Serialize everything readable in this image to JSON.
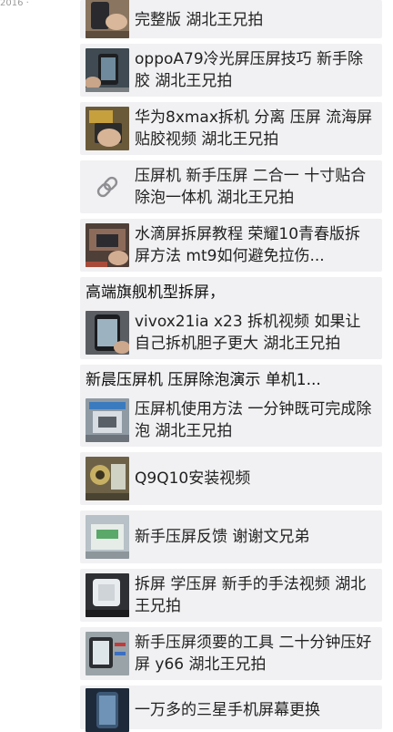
{
  "top_stub": "2016 ·",
  "feed": {
    "items": [
      {
        "title": "完整版 湖北王兄拍",
        "thumb": "thumb-phone-repair-hands"
      },
      {
        "title": "oppoA79冷光屏压屏技巧 新手除胶 湖北王兄拍",
        "thumb": "thumb-phone-on-mat"
      },
      {
        "title": "华为8xmax拆机 分离 压屏 流海屏贴胶视频 湖北王兄拍",
        "thumb": "thumb-hand-on-phone"
      },
      {
        "title": "压屏机 新手压屏 二合一 十寸贴合除泡一体机 湖北王兄拍",
        "thumb": "link-icon"
      },
      {
        "title": "水滴屏拆屏教程 荣耀10青春版拆屏方法 mt9如何避免拉伤...",
        "thumb": "thumb-disassembly"
      },
      {
        "heading": "高端旗舰机型拆屏，",
        "title": "vivox21ia x23 拆机视频 如果让自己拆机胆子更大 湖北王兄拍",
        "thumb": "thumb-phone-screen"
      },
      {
        "heading": "新晨压屏机 压屏除泡演示 单机1...",
        "title": "压屏机使用方法 一分钟既可完成除泡 湖北王兄拍",
        "thumb": "thumb-press-machine"
      },
      {
        "title": "Q9Q10安装视频",
        "thumb": "thumb-q9-machine"
      },
      {
        "title": "新手压屏反馈 谢谢文兄弟",
        "thumb": "thumb-green-machine"
      },
      {
        "title": "拆屏 学压屏 新手的手法视频 湖北王兄拍",
        "thumb": "thumb-white-film"
      },
      {
        "title": "新手压屏须要的工具 二十分钟压好屏 y66 湖北王兄拍",
        "thumb": "thumb-tools"
      },
      {
        "title": "一万多的三星手机屏幕更换",
        "thumb": "thumb-samsung"
      }
    ]
  }
}
